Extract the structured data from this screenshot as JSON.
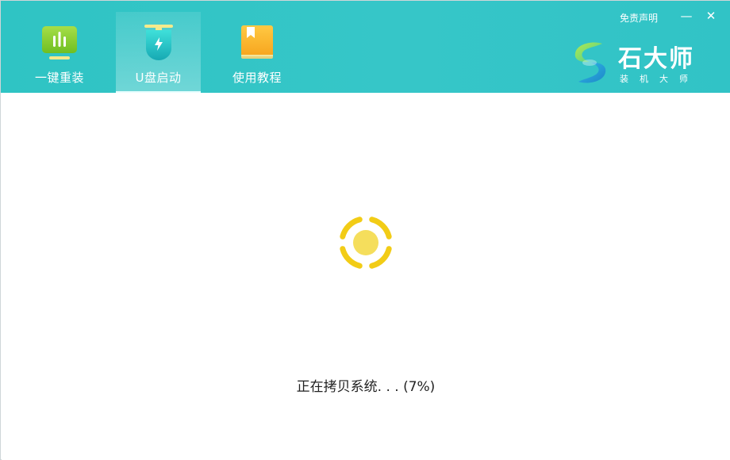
{
  "tabs": [
    {
      "label": "一键重装",
      "icon": "bar-chart-icon"
    },
    {
      "label": "U盘启动",
      "icon": "usb-drive-icon",
      "active": true
    },
    {
      "label": "使用教程",
      "icon": "book-icon"
    }
  ],
  "window": {
    "disclaimer": "免责声明",
    "minimize_glyph": "—",
    "close_glyph": "✕"
  },
  "brand": {
    "name": "石大师",
    "subtitle": "装机大师"
  },
  "status": {
    "text": "正在拷贝系统. . . (7%)",
    "progress_percent": 7
  },
  "colors": {
    "header": "#33c5c6",
    "spinner": "#f2cc16",
    "spinner_core": "#f5de5c"
  }
}
